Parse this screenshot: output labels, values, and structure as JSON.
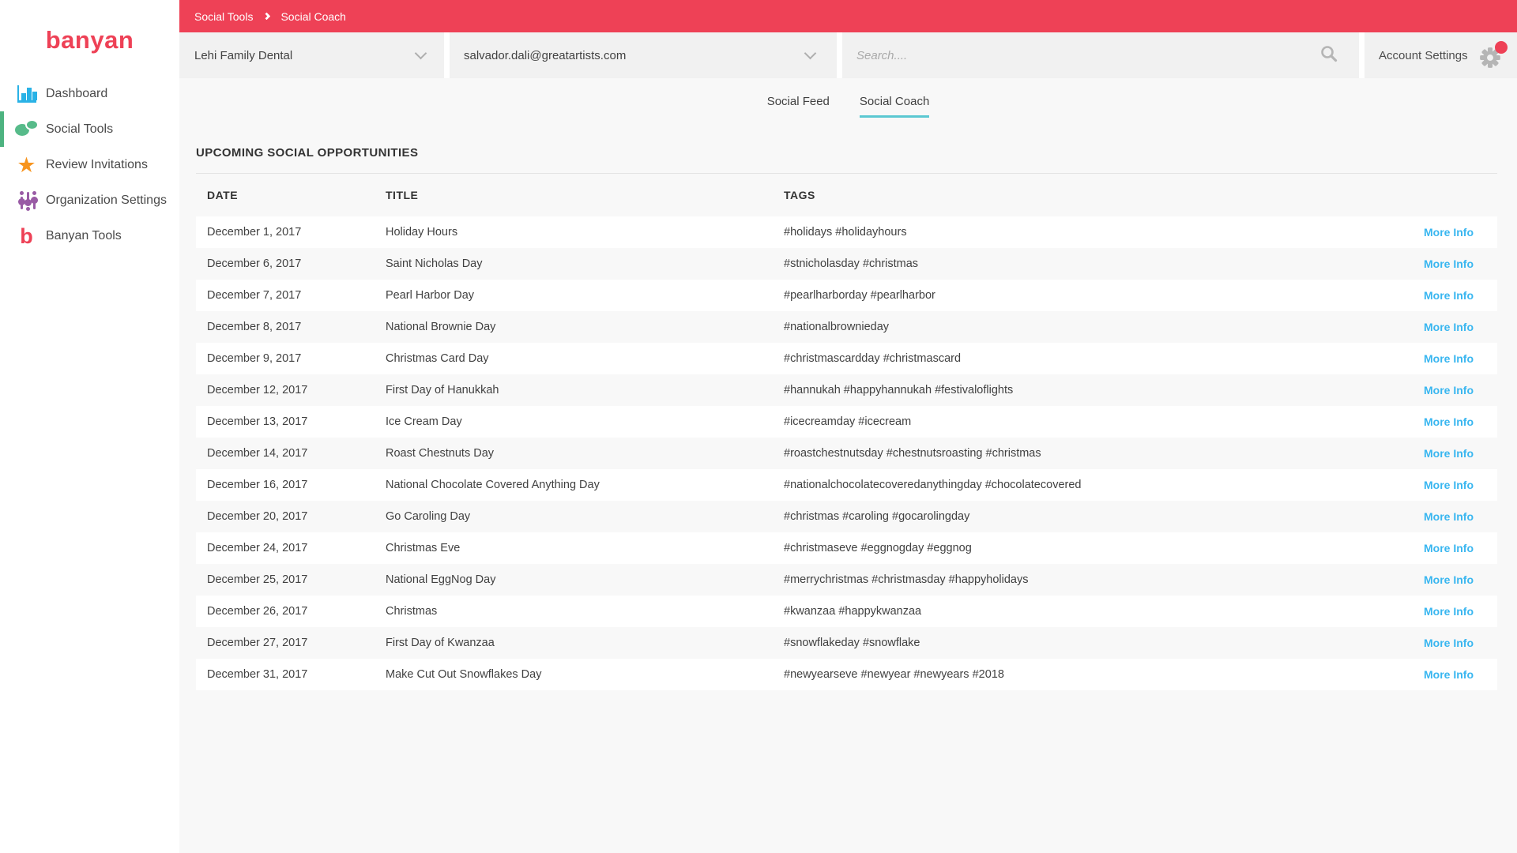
{
  "app": {
    "logo_text": "banyan"
  },
  "colors": {
    "brand_red": "#ee4156",
    "active_green": "#4db380",
    "dashboard_blue": "#29b2e6",
    "social_green": "#57bb8a",
    "star_orange": "#f7941e",
    "sliders_purple": "#995ba5",
    "tab_teal": "#5bc8d2",
    "link_blue": "#38b6f0"
  },
  "sidebar": {
    "items": [
      {
        "label": "Dashboard",
        "icon": "bar-chart-icon",
        "active": false
      },
      {
        "label": "Social Tools",
        "icon": "chat-bubbles-icon",
        "active": true
      },
      {
        "label": "Review Invitations",
        "icon": "star-icon",
        "active": false
      },
      {
        "label": "Organization Settings",
        "icon": "sliders-icon",
        "active": false
      },
      {
        "label": "Banyan Tools",
        "icon": "banyan-b-icon",
        "active": false
      }
    ]
  },
  "breadcrumb": {
    "items": [
      "Social Tools",
      "Social Coach"
    ]
  },
  "header": {
    "org_dropdown": {
      "value": "Lehi Family Dental"
    },
    "account_dropdown": {
      "value": "salvador.dali@greatartists.com"
    },
    "search": {
      "placeholder": "Search...."
    },
    "account_settings_label": "Account Settings",
    "notification_dot": true
  },
  "tabs": [
    {
      "label": "Social Feed",
      "active": false
    },
    {
      "label": "Social Coach",
      "active": true
    }
  ],
  "main": {
    "section_title": "UPCOMING SOCIAL OPPORTUNITIES",
    "table": {
      "columns": [
        "DATE",
        "TITLE",
        "TAGS"
      ],
      "more_info_label": "More Info",
      "rows": [
        {
          "date": "December 1, 2017",
          "title": "Holiday Hours",
          "tags": "#holidays #holidayhours"
        },
        {
          "date": "December 6, 2017",
          "title": "Saint Nicholas Day",
          "tags": "#stnicholasday #christmas"
        },
        {
          "date": "December 7, 2017",
          "title": "Pearl Harbor Day",
          "tags": "#pearlharborday #pearlharbor"
        },
        {
          "date": "December 8, 2017",
          "title": "National Brownie Day",
          "tags": "#nationalbrownieday"
        },
        {
          "date": "December 9, 2017",
          "title": "Christmas Card Day",
          "tags": "#christmascardday #christmascard"
        },
        {
          "date": "December 12, 2017",
          "title": "First Day of Hanukkah",
          "tags": "#hannukah #happyhannukah #festivaloflights"
        },
        {
          "date": "December 13, 2017",
          "title": "Ice Cream Day",
          "tags": "#icecreamday #icecream"
        },
        {
          "date": "December 14, 2017",
          "title": "Roast Chestnuts Day",
          "tags": "#roastchestnutsday #chestnutsroasting #christmas"
        },
        {
          "date": "December 16, 2017",
          "title": "National Chocolate Covered Anything Day",
          "tags": "#nationalchocolatecoveredanythingday #chocolatecovered"
        },
        {
          "date": "December 20, 2017",
          "title": "Go Caroling Day",
          "tags": "#christmas #caroling #gocarolingday"
        },
        {
          "date": "December 24, 2017",
          "title": "Christmas Eve",
          "tags": "#christmaseve #eggnogday #eggnog"
        },
        {
          "date": "December 25, 2017",
          "title": "National EggNog Day",
          "tags": "#merrychristmas #christmasday #happyholidays"
        },
        {
          "date": "December 26, 2017",
          "title": "Christmas",
          "tags": "#kwanzaa #happykwanzaa"
        },
        {
          "date": "December 27, 2017",
          "title": "First Day of Kwanzaa",
          "tags": "#snowflakeday #snowflake"
        },
        {
          "date": "December 31, 2017",
          "title": "Make Cut Out Snowflakes Day",
          "tags": "#newyearseve #newyear #newyears #2018"
        }
      ]
    }
  }
}
